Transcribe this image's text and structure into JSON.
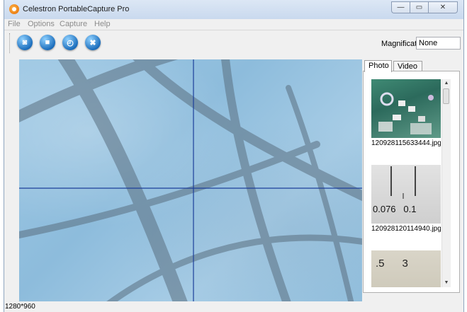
{
  "window": {
    "title": "Celestron PortableCapture Pro"
  },
  "menu": [
    "File",
    "Options",
    "Capture",
    "Help"
  ],
  "toolbar": {
    "buttons": [
      {
        "icon": "snapshot-icon"
      },
      {
        "icon": "video-camera-icon"
      },
      {
        "icon": "timer-icon"
      },
      {
        "icon": "exit-icon"
      }
    ],
    "magnification_label": "Magnification:",
    "magnification_value": "None"
  },
  "tabs": [
    {
      "label": "Photo",
      "active": true
    },
    {
      "label": "Video",
      "active": false
    }
  ],
  "thumbnails": [
    {
      "caption": "120928115633444.jpg"
    },
    {
      "caption": "120928120114940.jpg",
      "overlay_text": "0.076   0.1"
    },
    {
      "caption": "",
      "overlay_text": ".5      3"
    }
  ],
  "status": {
    "resolution": "1280*960"
  },
  "colors": {
    "crosshair": "#1c3f9a",
    "viewport_bg": "#9ec8e4"
  }
}
